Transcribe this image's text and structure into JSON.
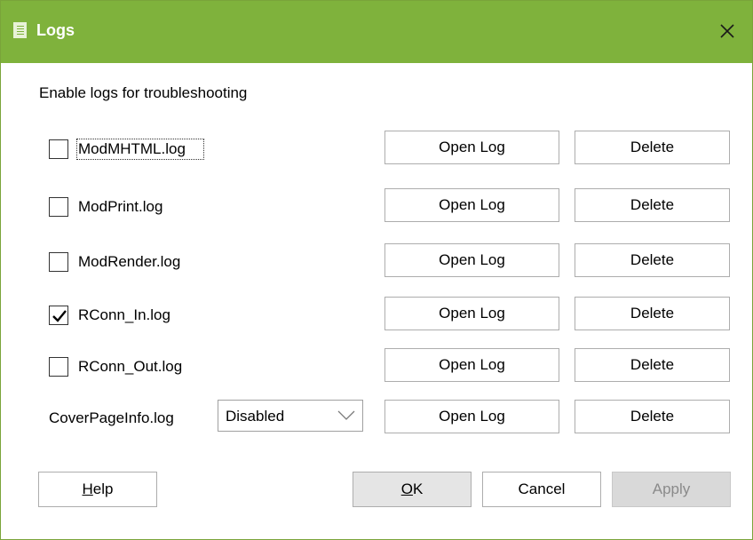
{
  "window": {
    "title": "Logs"
  },
  "intro_text": "Enable logs for troubleshooting",
  "logs": [
    {
      "name": "ModMHTML.log",
      "checked": false,
      "focused": true,
      "open_label": "Open Log",
      "delete_label": "Delete"
    },
    {
      "name": "ModPrint.log",
      "checked": false,
      "focused": false,
      "open_label": "Open Log",
      "delete_label": "Delete"
    },
    {
      "name": "ModRender.log",
      "checked": false,
      "focused": false,
      "open_label": "Open Log",
      "delete_label": "Delete"
    },
    {
      "name": "RConn_In.log",
      "checked": true,
      "focused": false,
      "open_label": "Open Log",
      "delete_label": "Delete"
    },
    {
      "name": "RConn_Out.log",
      "checked": false,
      "focused": false,
      "open_label": "Open Log",
      "delete_label": "Delete"
    }
  ],
  "cover_page": {
    "name": "CoverPageInfo.log",
    "select_value": "Disabled",
    "open_label": "Open Log",
    "delete_label": "Delete"
  },
  "footer": {
    "help_mnemonic": "H",
    "help_rest": "elp",
    "ok_mnemonic": "O",
    "ok_rest": "K",
    "cancel_label": "Cancel",
    "apply_label": "Apply"
  },
  "colors": {
    "titlebar": "#7fb23c",
    "title_text": "#ffffff"
  }
}
